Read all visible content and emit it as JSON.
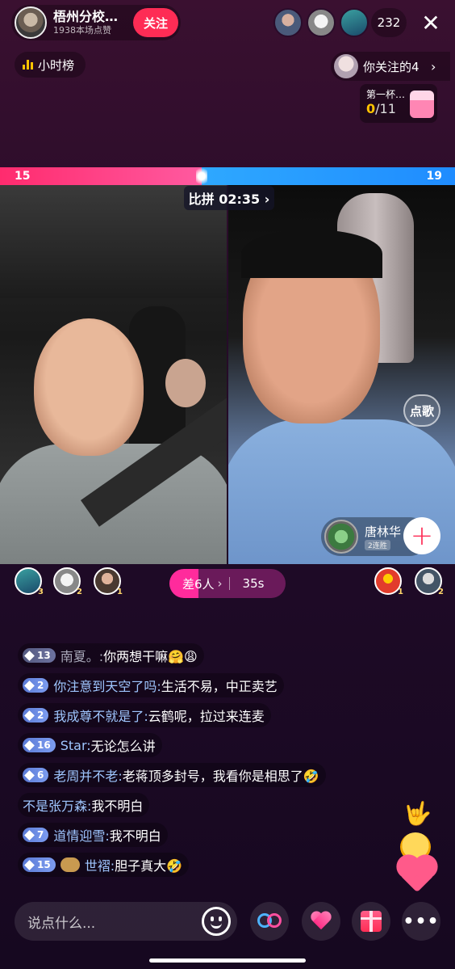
{
  "host": {
    "name": "梧州分校…",
    "likes": "1938本场点赞",
    "follow_label": "关注"
  },
  "viewers": {
    "count": "232"
  },
  "close_label": "✕",
  "hour_rank": {
    "label": "小时榜"
  },
  "follow_notice": {
    "text": "你关注的4",
    "arrow": "›"
  },
  "task": {
    "title": "第一杯…",
    "current": "0",
    "total": "/11"
  },
  "pk": {
    "left_score": "15",
    "right_score": "19",
    "left_share": 0.443,
    "timer": "比拼 02:35 ›",
    "gap_label": "差6人",
    "gap_arrow": "›",
    "countdown": "35s",
    "gap_progress": 0.25
  },
  "song_request": {
    "label": "点歌"
  },
  "opponent": {
    "name": "唐林华",
    "badge": "2连胜",
    "add_label": "+"
  },
  "pk_ranks": {
    "left": [
      "3",
      "2",
      "1"
    ],
    "right": [
      "1",
      "2"
    ]
  },
  "comments": [
    {
      "level": "13",
      "level_style": "gray",
      "user": "南夏。:",
      "text": "你两想干嘛🤗😩",
      "user_style": "dim"
    },
    {
      "level": "2",
      "level_style": "blue",
      "user": "你注意到天空了吗:",
      "text": "生活不易，中正卖艺",
      "user_style": "blue"
    },
    {
      "level": "2",
      "level_style": "blue",
      "user": "我成尊不就是了:",
      "text": "云鹤呢，拉过来连麦",
      "user_style": "blue"
    },
    {
      "level": "16",
      "level_style": "blue",
      "user": "Star:",
      "text": "无论怎么讲",
      "user_style": "blue"
    },
    {
      "level": "6",
      "level_style": "blue",
      "user": "老周并不老:",
      "text": "老蒋顶多封号，我看你是相思了🤣",
      "user_style": "blue"
    },
    {
      "level": "",
      "level_style": "none",
      "user": "不是张万森:",
      "text": "我不明白",
      "user_style": "blue"
    },
    {
      "level": "7",
      "level_style": "blue",
      "user": "道情迎雪:",
      "text": "我不明白",
      "user_style": "blue"
    },
    {
      "level": "15",
      "level_style": "blue",
      "user": "世褶:",
      "text": "胆子真大🤣",
      "user_style": "blue",
      "fan_badge": true
    }
  ],
  "float_fx": {
    "hand": "🤟"
  },
  "chat_input": {
    "placeholder": "说点什么..."
  },
  "more_label": "•••",
  "colors": {
    "follow": "#fe2c55",
    "pk_left": "#ff2b6e",
    "pk_right": "#1f8cff",
    "accent_gold": "#ffc300"
  }
}
